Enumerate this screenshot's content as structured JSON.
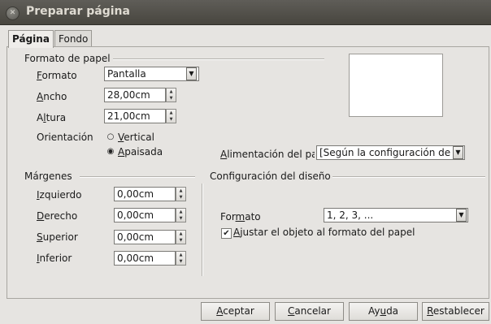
{
  "window": {
    "title": "Preparar página"
  },
  "tabs": [
    {
      "label": "Página"
    },
    {
      "label": "Fondo"
    }
  ],
  "paper_format": {
    "section_title": "Formato de papel",
    "format": {
      "label_first": "F",
      "label_rest": "ormato",
      "value": "Pantalla"
    },
    "width": {
      "label_first": "A",
      "label_rest": "ncho",
      "value": "28,00cm"
    },
    "height": {
      "label_pre": "A",
      "label_u": "l",
      "label_rest": "tura",
      "value": "21,00cm"
    },
    "orientation": {
      "label": "Orientación",
      "portrait": {
        "label_first": "V",
        "label_rest": "ertical",
        "selected": false
      },
      "landscape": {
        "label_first": "A",
        "label_rest": "paisada",
        "selected": true
      }
    },
    "paper_tray": {
      "label_first": "A",
      "label_rest": "limentación del pa",
      "value": "[Según la configuración de la i"
    }
  },
  "margins": {
    "section_title": "Márgenes",
    "left": {
      "label_first": "I",
      "label_rest": "zquierdo",
      "value": "0,00cm"
    },
    "right": {
      "label_first": "D",
      "label_rest": "erecho",
      "value": "0,00cm"
    },
    "top": {
      "label_first": "S",
      "label_rest": "uperior",
      "value": "0,00cm"
    },
    "bottom": {
      "label_first": "I",
      "label_rest": "nferior",
      "value": "0,00cm"
    }
  },
  "layout_settings": {
    "section_title": "Configuración del diseño",
    "format": {
      "label_pre": "For",
      "label_u": "m",
      "label_rest": "ato",
      "value": "1, 2, 3, ..."
    },
    "fit_object": {
      "label_first": "A",
      "label_rest": "justar el objeto al formato del papel",
      "checked": true
    }
  },
  "buttons": {
    "ok": {
      "first": "A",
      "rest": "ceptar"
    },
    "cancel": {
      "first": "C",
      "rest": "ancelar"
    },
    "help": {
      "pre": "Ay",
      "u": "u",
      "rest": "da"
    },
    "reset": {
      "first": "R",
      "rest": "establecer"
    }
  },
  "icons": {
    "close": "close-icon",
    "spin": "spin-arrows-icon",
    "dropdown": "chevron-down-icon",
    "check": "checkmark-icon"
  },
  "colors": {
    "titlebar": "#4f4d48",
    "title_text": "#dfdbd2",
    "dialog_bg": "#e6e4e1"
  }
}
